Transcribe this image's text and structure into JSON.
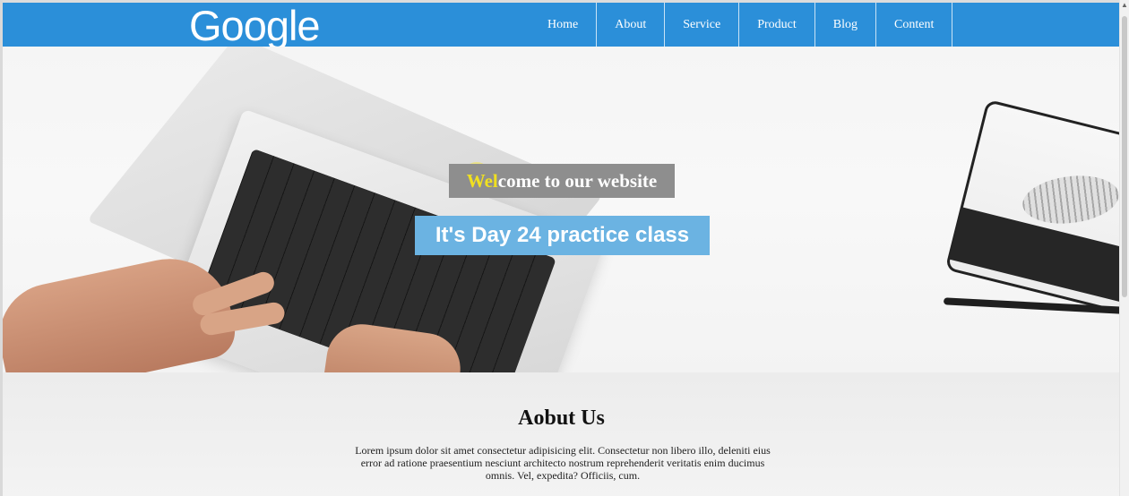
{
  "brand": {
    "logo_text": "Google"
  },
  "nav": {
    "items": [
      {
        "label": "Home"
      },
      {
        "label": "About"
      },
      {
        "label": "Service"
      },
      {
        "label": "Product"
      },
      {
        "label": "Blog"
      },
      {
        "label": "Content"
      }
    ]
  },
  "hero": {
    "welcome_highlight": "Wel",
    "welcome_rest": "come to our website",
    "button_label": "It's Day 24 practice class"
  },
  "about": {
    "title": "Aobut Us",
    "text": "Lorem ipsum dolor sit amet consectetur adipisicing elit. Consectetur non libero illo, deleniti eius error ad ratione praesentium nesciunt architecto nostrum reprehenderit veritatis enim ducimus omnis. Vel, expedita? Officiis, cum."
  },
  "colors": {
    "nav_bg": "#2b8fd9",
    "welcome_bg": "#8e8e8e",
    "button_bg": "#6bb3e2",
    "highlight": "#f0e020"
  },
  "icons": [
    "scroll-up-arrow-icon"
  ]
}
